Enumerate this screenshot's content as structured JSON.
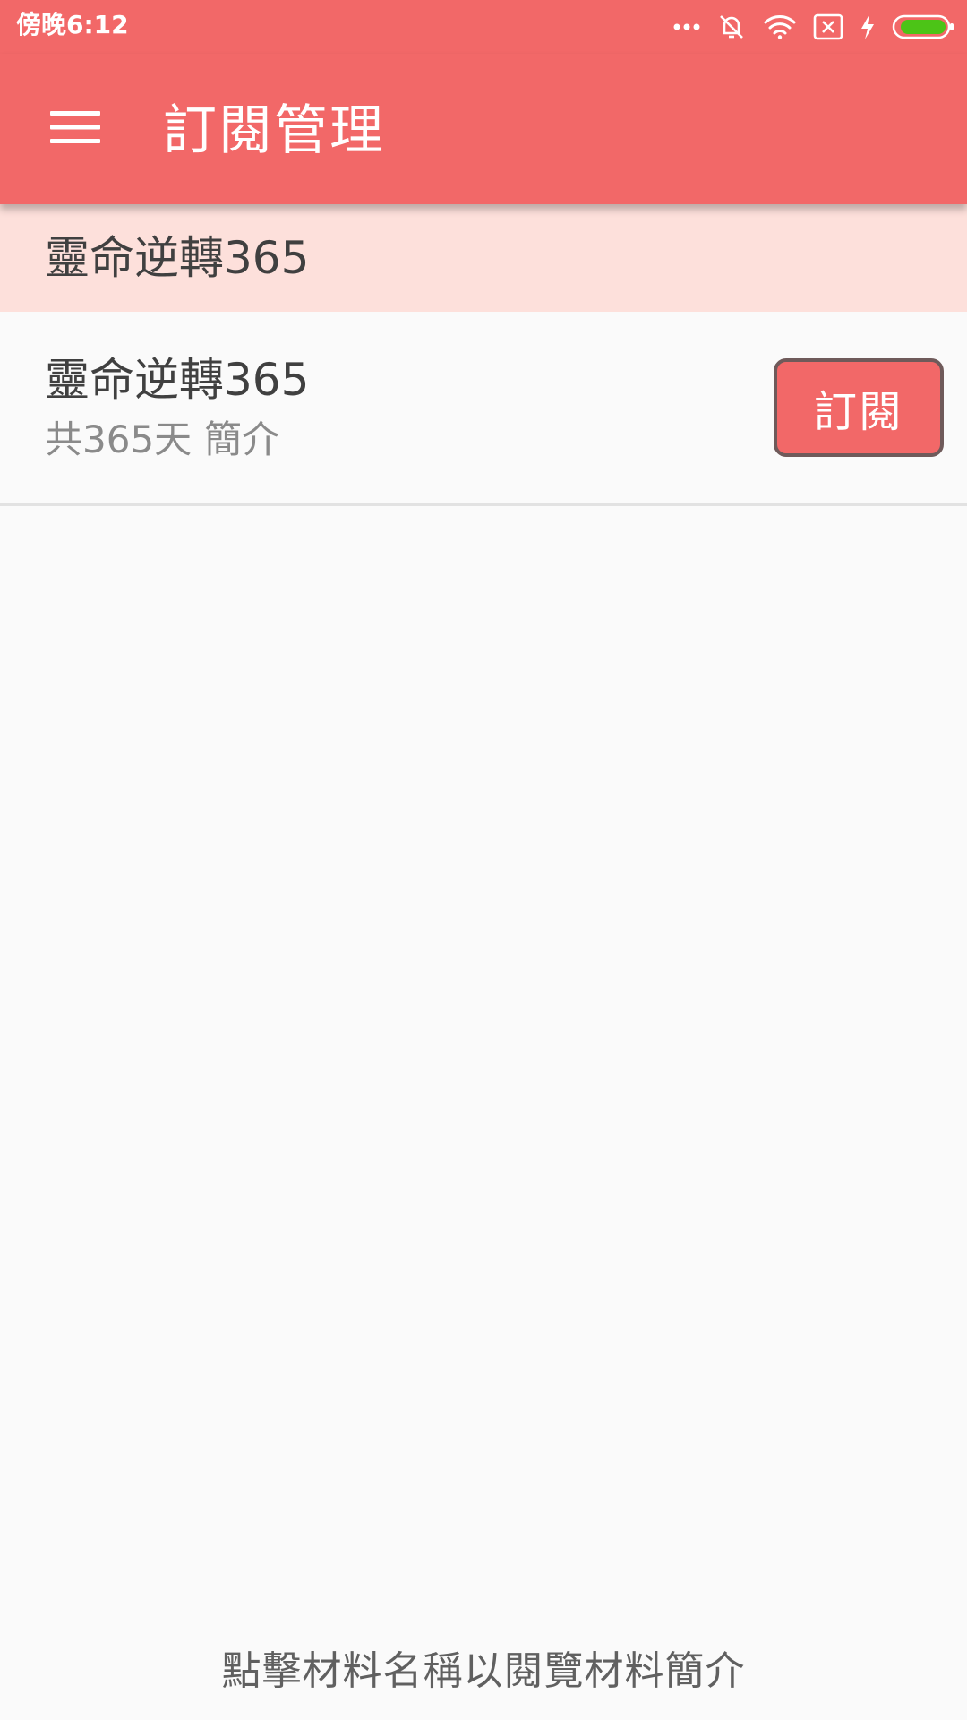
{
  "status_bar": {
    "time": "傍晚6:12",
    "icons": [
      "more-dots-icon",
      "silent-bell-icon",
      "wifi-icon",
      "no-sim-icon",
      "charging-bolt-icon",
      "battery-icon"
    ],
    "battery_color": "#4cc417"
  },
  "app_bar": {
    "title": "訂閱管理",
    "menu_icon": "hamburger-menu-icon",
    "background": "#f26868"
  },
  "section_header": {
    "title": "靈命逆轉365",
    "background": "#fde0db"
  },
  "plans": [
    {
      "title": "靈命逆轉365",
      "duration": "共365天",
      "intro_label": "簡介",
      "subscribe_label": "訂閱"
    }
  ],
  "footer": {
    "hint": "點擊材料名稱以閱覽材料簡介"
  }
}
